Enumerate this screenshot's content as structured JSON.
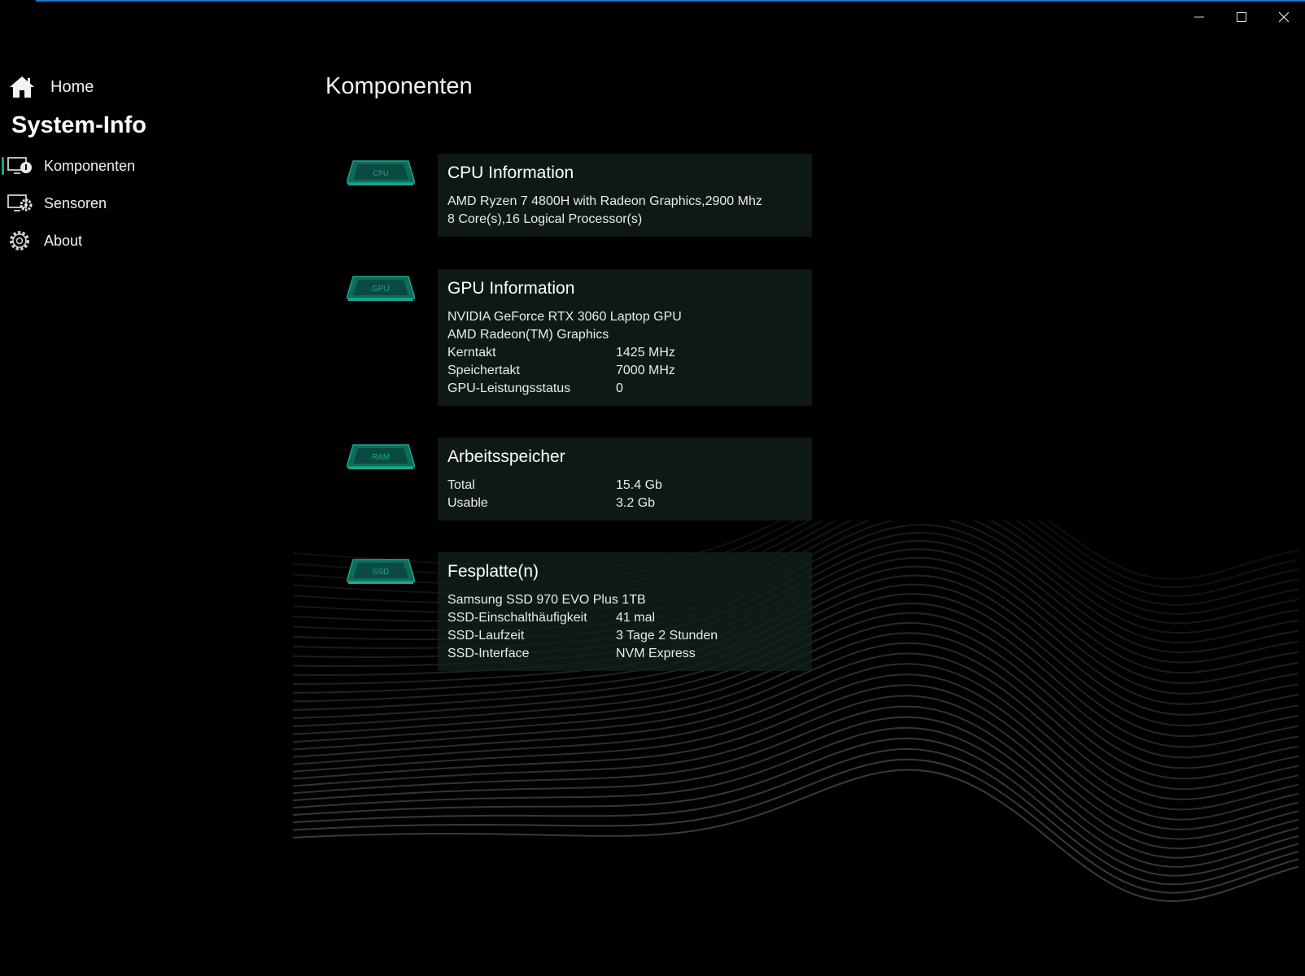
{
  "window": {
    "accent_color": "#1677d2",
    "controls": [
      "minimize-icon",
      "maximize-icon",
      "close-icon"
    ]
  },
  "sidebar": {
    "home_label": "Home",
    "section_title": "System-Info",
    "items": [
      {
        "label": "Komponenten",
        "icon": "monitor-info-icon",
        "selected": true
      },
      {
        "label": "Sensoren",
        "icon": "monitor-gear-icon",
        "selected": false
      },
      {
        "label": "About",
        "icon": "gear-icon",
        "selected": false
      }
    ]
  },
  "main": {
    "title": "Komponenten",
    "chip_color": "#1aa58a",
    "cards": {
      "cpu": {
        "chip_label": "CPU",
        "title": "CPU Information",
        "lines": [
          "AMD Ryzen 7 4800H with Radeon Graphics,2900 Mhz",
          "8 Core(s),16 Logical Processor(s)"
        ]
      },
      "gpu": {
        "chip_label": "GPU",
        "title": "GPU Information",
        "lines": [
          "NVIDIA GeForce RTX 3060 Laptop GPU",
          "AMD Radeon(TM) Graphics"
        ],
        "rows": [
          {
            "key": "Kerntakt",
            "value": "1425 MHz"
          },
          {
            "key": "Speichertakt",
            "value": "7000 MHz"
          },
          {
            "key": "GPU-Leistungsstatus",
            "value": "0"
          }
        ]
      },
      "ram": {
        "chip_label": "RAM",
        "title": "Arbeitsspeicher",
        "rows": [
          {
            "key": "Total",
            "value": "15.4 Gb"
          },
          {
            "key": "Usable",
            "value": "3.2 Gb"
          }
        ]
      },
      "disk": {
        "chip_label": "SSD",
        "title": "Fesplatte(n)",
        "lines": [
          "Samsung SSD 970 EVO Plus 1TB"
        ],
        "rows": [
          {
            "key": "SSD-Einschalthäufigkeit",
            "value": "41 mal"
          },
          {
            "key": "SSD-Laufzeit",
            "value": "3 Tage 2 Stunden"
          },
          {
            "key": "SSD-Interface",
            "value": "NVM Express"
          }
        ]
      }
    }
  }
}
